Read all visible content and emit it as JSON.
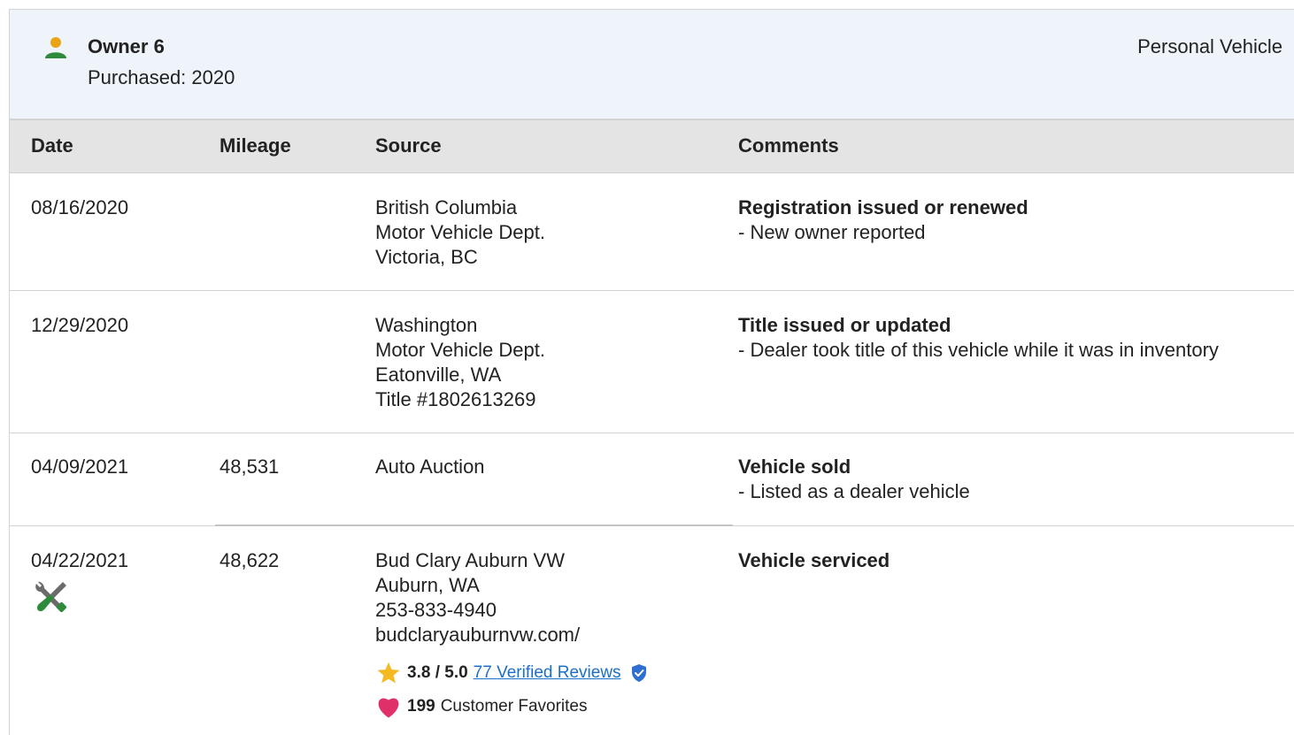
{
  "owner": {
    "title": "Owner 6",
    "purchased": "Purchased: 2020",
    "type": "Personal Vehicle"
  },
  "columns": {
    "date": "Date",
    "mileage": "Mileage",
    "source": "Source",
    "comments": "Comments"
  },
  "records": [
    {
      "date": "08/16/2020",
      "mileage": "",
      "source": [
        "British Columbia",
        "Motor Vehicle Dept.",
        "Victoria, BC"
      ],
      "comment_title": "Registration issued or renewed",
      "comment_detail": "- New owner reported"
    },
    {
      "date": "12/29/2020",
      "mileage": "",
      "source": [
        "Washington",
        "Motor Vehicle Dept.",
        "Eatonville, WA",
        "Title #1802613269"
      ],
      "comment_title": "Title issued or updated",
      "comment_detail": "- Dealer took title of this vehicle while it was in inventory"
    },
    {
      "date": "04/09/2021",
      "mileage": "48,531",
      "source": [
        "Auto Auction"
      ],
      "comment_title": "Vehicle sold",
      "comment_detail": "- Listed as a dealer vehicle"
    },
    {
      "date": "04/22/2021",
      "mileage": "48,622",
      "source": [
        "Bud Clary Auburn VW",
        "Auburn, WA",
        "253-833-4940",
        "budclaryauburnvw.com/"
      ],
      "comment_title": "Vehicle serviced",
      "comment_detail": ""
    }
  ],
  "dealer": {
    "rating": "3.8 / 5.0",
    "reviews_link": "77 Verified Reviews",
    "favorites_count": "199",
    "favorites_label": "Customer Favorites"
  },
  "icons": {
    "owner": "person-icon",
    "service": "wrench-screwdriver-icon",
    "rating": "star-icon",
    "verified": "verified-shield-icon",
    "favorites": "heart-icon"
  },
  "colors": {
    "owner_icon": "#2e8b3c",
    "owner_icon_head": "#e8a317",
    "header_bg": "#eef4fa",
    "table_header_bg": "#e4e4e4",
    "link": "#1a6fc8",
    "star": "#f5b921",
    "heart": "#e0306a",
    "shield": "#2f6fd1",
    "service_icon_green": "#2e8b3c"
  }
}
